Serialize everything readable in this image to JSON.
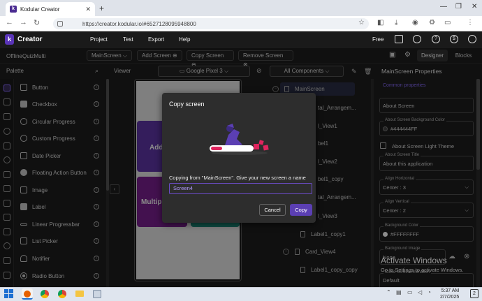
{
  "browser": {
    "tab_title": "Kodular Creator",
    "new_tab": "+",
    "url": "https://creator.kodular.io/#6527128095948800"
  },
  "app": {
    "brand": "Creator",
    "logo_letter": "k",
    "menu": [
      "Project",
      "Test",
      "Export",
      "Help"
    ],
    "free_label": "Free"
  },
  "project": {
    "name": "OfflineQuizMulti",
    "screen_select": "MainScreen",
    "add_screen": "Add Screen",
    "copy_screen": "Copy Screen",
    "remove_screen": "Remove Screen",
    "designer": "Designer",
    "blocks": "Blocks"
  },
  "palette": {
    "title": "Palette",
    "items": [
      "Button",
      "Checkbox",
      "Circular Progress",
      "Custom Progress",
      "Date Picker",
      "Floating Action Button",
      "Image",
      "Label",
      "Linear Progressbar",
      "List Picker",
      "Notifier",
      "Radio Button"
    ]
  },
  "viewer": {
    "title": "Viewer",
    "device": "Google Pixel 3",
    "card1_text": "Add",
    "card2_text": "Multipl"
  },
  "components": {
    "selector": "All Components",
    "items": [
      "MainScreen",
      "tal_Arrangem...",
      "l_View1",
      "bel1",
      "l_View2",
      "bel1_copy",
      "tal_Arrangem...",
      "l_View3",
      "Label1_copy1",
      "Card_View4",
      "Label1_copy_copy"
    ]
  },
  "properties": {
    "title": "MainScreen Properties",
    "common": "Common properties",
    "about_screen": "About Screen",
    "bg_color_label": "About Screen Background Color",
    "bg_color_value": "#444444FF",
    "light_theme": "About Screen Light Theme",
    "title_label": "About Screen Title",
    "title_value": "About this application",
    "align_h_label": "Align Horizontal",
    "align_h_value": "Center : 3",
    "align_v_label": "Align Vertical",
    "align_v_value": "Center : 2",
    "bgc_label": "Background Color",
    "bgc_value": "#FFFFFFFF",
    "bgimg_label": "Background Image",
    "bgimg_value": "None",
    "close_anim_label": "Close Screen Animation",
    "close_anim_value": "Default"
  },
  "dialog": {
    "title": "Copy screen",
    "message": "Copying from \"MainScreen\". Give your new screen a name",
    "input_value": "Screen4",
    "cancel": "Cancel",
    "copy": "Copy"
  },
  "watermark": {
    "line1": "Activate Windows",
    "line2": "Go to Settings to activate Windows."
  },
  "taskbar": {
    "time": "5:37 AM",
    "date": "2/7/2025",
    "badge": "2"
  },
  "colors": {
    "accent": "#5b3fb3",
    "brand": "#5a34b8",
    "swatch_dark": "#444444",
    "swatch_white": "#ffffff"
  }
}
